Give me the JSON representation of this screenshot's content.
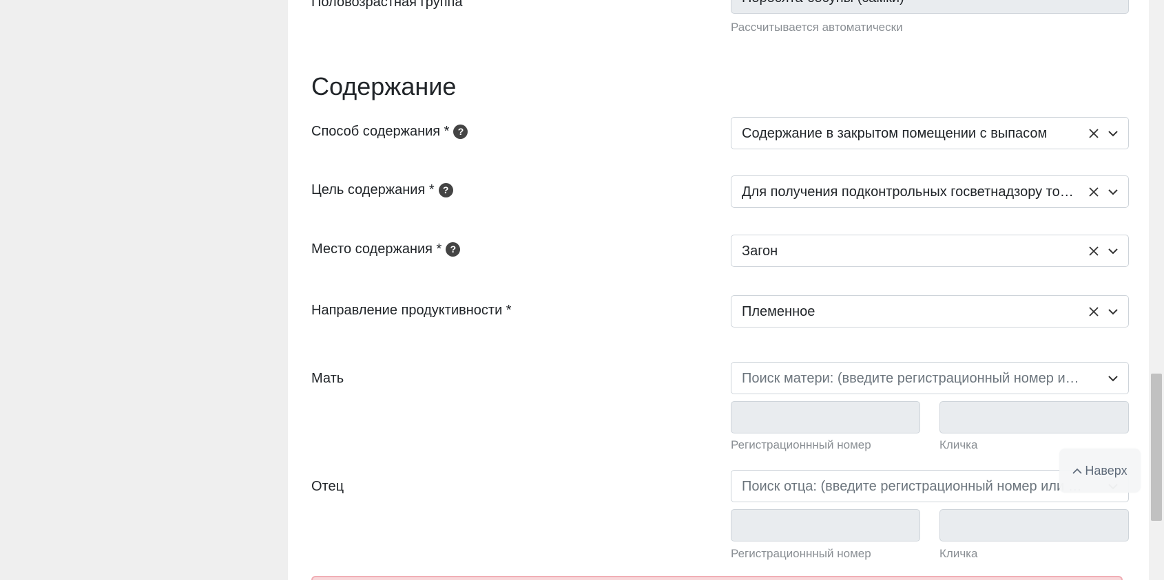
{
  "top": {
    "label": "Половозрастная группа",
    "value": "Поросята-сосуны (самки)",
    "hint": "Рассчитывается автоматически"
  },
  "section": {
    "title": "Содержание"
  },
  "fields": {
    "method": {
      "label": "Способ содержания *",
      "value": "Содержание в закрытом помещении с выпасом"
    },
    "purpose": {
      "label": "Цель содержания *",
      "value": "Для получения подконтрольных госветнадзору товаров"
    },
    "place": {
      "label": "Место содержания *",
      "value": "Загон"
    },
    "direction": {
      "label": "Направление продуктивности *",
      "value": "Племенное"
    },
    "mother": {
      "label": "Мать",
      "placeholder": "Поиск матери: (введите регистрационный номер или кличку)",
      "reg_hint": "Регистрационнный номер",
      "name_hint": "Кличка"
    },
    "father": {
      "label": "Отец",
      "placeholder": "Поиск отца: (введите регистрационный номер или кличку)",
      "reg_hint": "Регистрационнный номер",
      "name_hint": "Кличка"
    }
  },
  "help_glyph": "?",
  "back_to_top": "Наверх",
  "icons": {
    "help": "question-circle-icon",
    "clear": "close-icon",
    "dropdown": "chevron-down-icon",
    "up": "chevron-up-icon"
  },
  "colors": {
    "border": "#ced4da",
    "readonly_bg": "#e9ecef",
    "hint": "#8a8f94",
    "help_bg": "#444444",
    "alert_border": "#f1aeb5"
  }
}
